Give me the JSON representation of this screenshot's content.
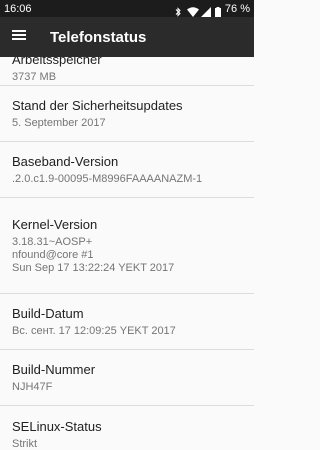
{
  "status_bar": {
    "time": "16:06",
    "battery_percent": "76 %",
    "icons": [
      "bluetooth-icon",
      "wifi-icon",
      "cell-signal-icon",
      "battery-icon"
    ]
  },
  "app_bar": {
    "title": "Telefonstatus",
    "menu_icon": "hamburger-menu-icon"
  },
  "items": [
    {
      "label": "Arbeitsspeicher",
      "value": "3737 MB"
    },
    {
      "label": "Stand der Sicherheitsupdates",
      "value": "5. September 2017"
    },
    {
      "label": "Baseband-Version",
      "value": ".2.0.c1.9-00095-M8996FAAAANAZM-1"
    },
    {
      "label": "Kernel-Version",
      "value": "3.18.31~AOSP+\nnfound@core #1\nSun Sep 17 13:22:24 YEKT 2017"
    },
    {
      "label": "Build-Datum",
      "value": "Вс. сент. 17 12:09:25 YEKT 2017"
    },
    {
      "label": "Build-Nummer",
      "value": "NJH47F"
    },
    {
      "label": "SELinux-Status",
      "value": "Strikt"
    }
  ],
  "colors": {
    "status_bar": "#1c1c1c",
    "app_bar": "#2b2b2b",
    "background": "#fafafa",
    "divider": "#dcdcdc"
  }
}
